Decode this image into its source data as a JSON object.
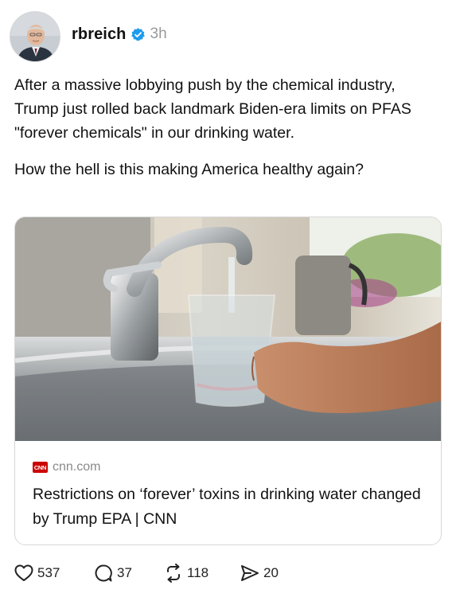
{
  "post": {
    "author": {
      "handle": "rbreich",
      "verified": true,
      "time": "3h",
      "avatar_icon": "avatar-photo"
    },
    "paragraphs": [
      "After a massive lobbying push by the chemical industry, Trump just rolled back landmark Biden-era limits on PFAS \"forever chemicals\" in our drinking water.",
      "How the hell is this making America healthy again?"
    ],
    "link_card": {
      "image_icon": "faucet-water-glass-photo",
      "source_logo": "CNN",
      "domain": "cnn.com",
      "title": "Restrictions on ‘forever’ toxins in drinking water changed by Trump EPA | CNN"
    },
    "actions": {
      "likes": "537",
      "replies": "37",
      "reposts": "118",
      "shares": "20"
    }
  },
  "colors": {
    "verified_badge": "#1d9bf0",
    "cnn_red": "#cc0000",
    "muted_text": "#9a9a9a"
  }
}
